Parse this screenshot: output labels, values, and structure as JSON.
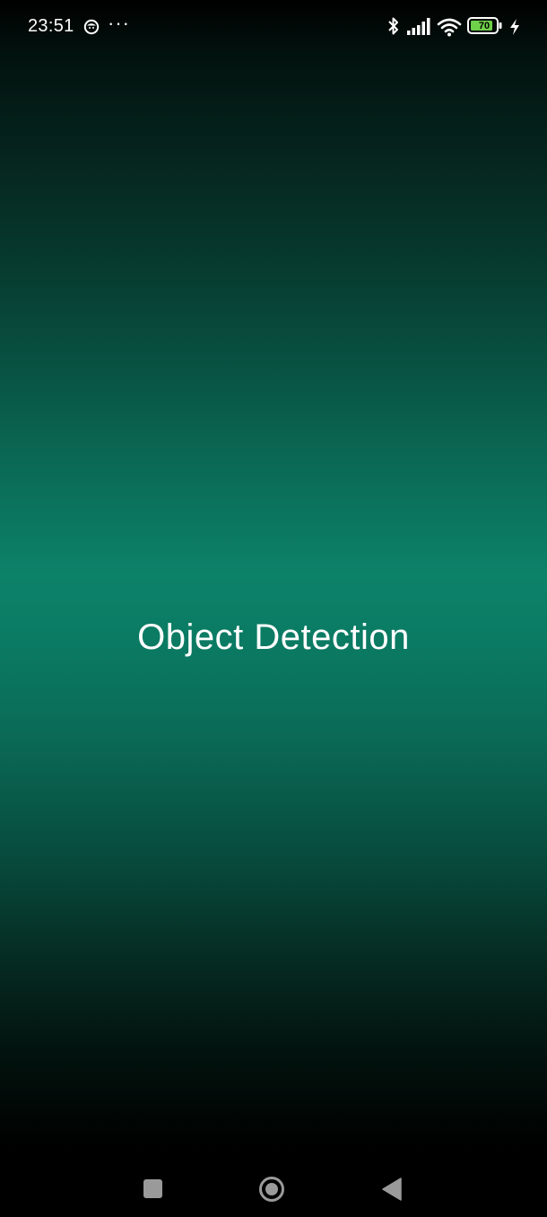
{
  "status_bar": {
    "time": "23:51",
    "more": "···",
    "battery_level": "70",
    "icons": [
      "app-notification-icon",
      "bluetooth-icon",
      "cellular-signal-icon",
      "wifi-icon",
      "battery-icon",
      "charging-icon"
    ]
  },
  "main": {
    "title": "Object Detection"
  },
  "nav_bar": {
    "buttons": [
      "recents-button",
      "home-button",
      "back-button"
    ]
  },
  "colors": {
    "accent": "#0c8269",
    "battery_fill": "#6fd04a",
    "text": "#ffffff",
    "nav_icons": "#9a9a9a"
  }
}
